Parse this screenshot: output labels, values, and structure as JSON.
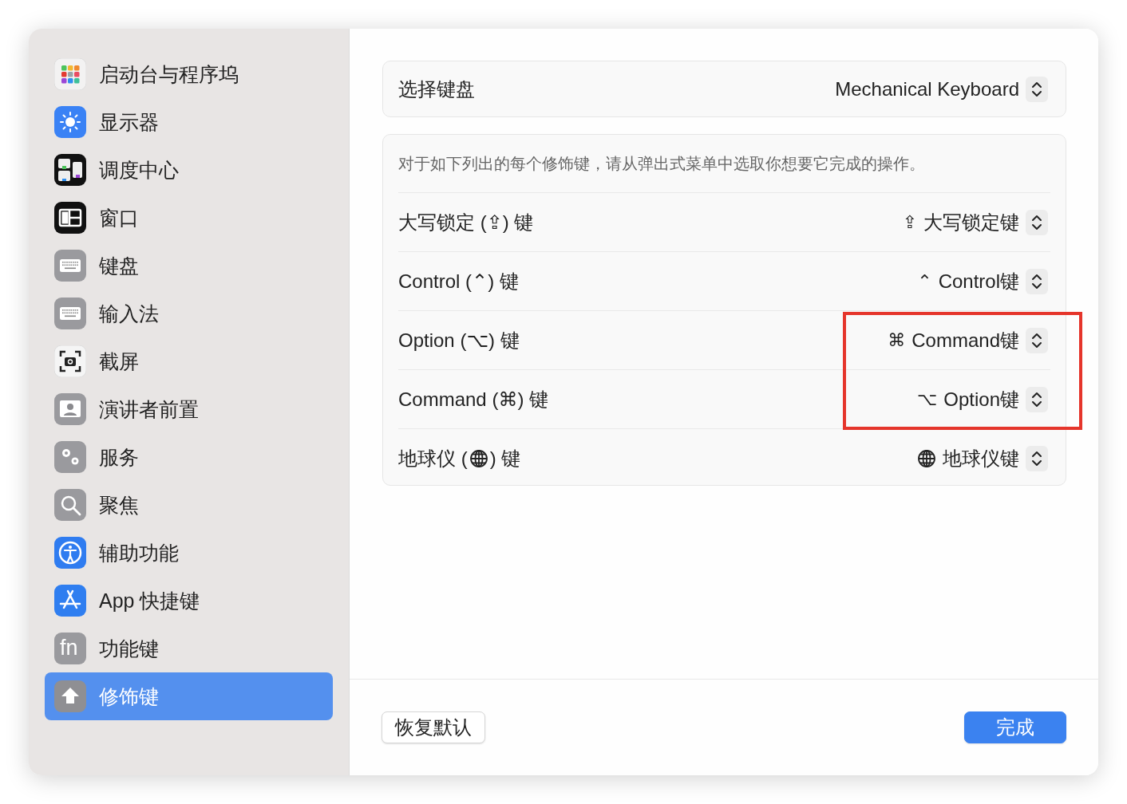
{
  "sidebar": {
    "items": [
      {
        "label": "启动台与程序坞",
        "selected": false
      },
      {
        "label": "显示器",
        "selected": false
      },
      {
        "label": "调度中心",
        "selected": false
      },
      {
        "label": "窗口",
        "selected": false
      },
      {
        "label": "键盘",
        "selected": false
      },
      {
        "label": "输入法",
        "selected": false
      },
      {
        "label": "截屏",
        "selected": false
      },
      {
        "label": "演讲者前置",
        "selected": false
      },
      {
        "label": "服务",
        "selected": false
      },
      {
        "label": "聚焦",
        "selected": false
      },
      {
        "label": "辅助功能",
        "selected": false
      },
      {
        "label": "App 快捷键",
        "selected": false
      },
      {
        "label": "功能键",
        "selected": false,
        "icon_text": "fn"
      },
      {
        "label": "修饰键",
        "selected": true
      }
    ]
  },
  "keyboard_select": {
    "label": "选择键盘",
    "value": "Mechanical Keyboard"
  },
  "description": "对于如下列出的每个修饰键，请从弹出式菜单中选取你想要它完成的操作。",
  "modifier_rows": [
    {
      "kind": "glyph",
      "label_start": "大写锁定 (",
      "symbol": "⇪",
      "label_end": ") 键",
      "value_symbol": "⇪",
      "value": "大写锁定键",
      "highlighted": false
    },
    {
      "kind": "glyph",
      "label_start": "Control (",
      "symbol": "⌃",
      "label_end": ") 键",
      "value_symbol": "⌃",
      "value": "Control键",
      "highlighted": false
    },
    {
      "kind": "glyph",
      "label_start": "Option (",
      "symbol": "⌥",
      "label_end": ") 键",
      "value_symbol": "⌘",
      "value": "Command键",
      "highlighted": true
    },
    {
      "kind": "glyph",
      "label_start": "Command (",
      "symbol": "⌘",
      "label_end": ") 键",
      "value_symbol": "⌥",
      "value": "Option键",
      "highlighted": true
    },
    {
      "kind": "globe",
      "label_start": "地球仪 (",
      "label_end": ") 键",
      "value": "地球仪键",
      "highlighted": false
    }
  ],
  "footer": {
    "restore_button": "恢复默认",
    "done_button": "完成"
  }
}
